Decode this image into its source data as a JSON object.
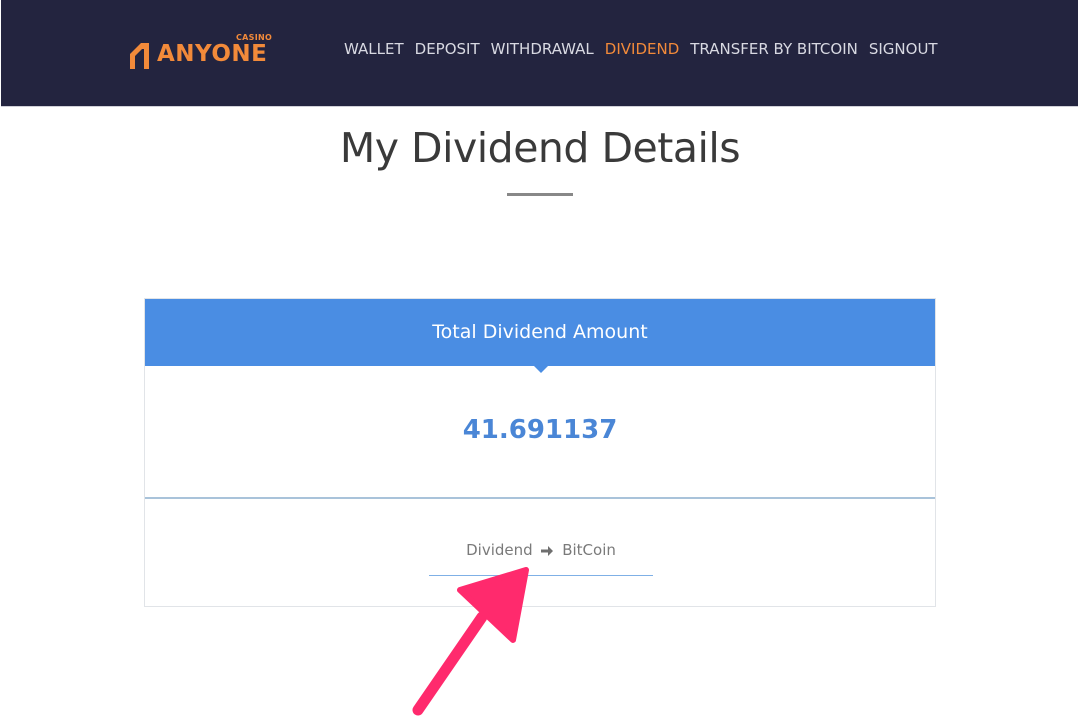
{
  "header": {
    "logo": {
      "brand": "ANYONE",
      "tagline": "CASINO",
      "accent_color": "#f28a3a"
    },
    "nav": [
      {
        "label": "WALLET",
        "active": false
      },
      {
        "label": "DEPOSIT",
        "active": false
      },
      {
        "label": "WITHDRAWAL",
        "active": false
      },
      {
        "label": "DIVIDEND",
        "active": true
      },
      {
        "label": "TRANSFER BY BITCOIN",
        "active": false
      },
      {
        "label": "SIGNOUT",
        "active": false
      }
    ],
    "background_color": "#23243f"
  },
  "page": {
    "title": "My Dividend Details"
  },
  "dividend_card": {
    "header_label": "Total Dividend Amount",
    "header_color": "#4a8de3",
    "amount": "41.691137",
    "amount_color": "#4a86d6",
    "convert_from": "Dividend",
    "convert_to": "BitCoin",
    "arrow_icon": "arrow-right-icon"
  },
  "annotation": {
    "icon": "callout-arrow-icon",
    "color": "#ff2a6d"
  }
}
